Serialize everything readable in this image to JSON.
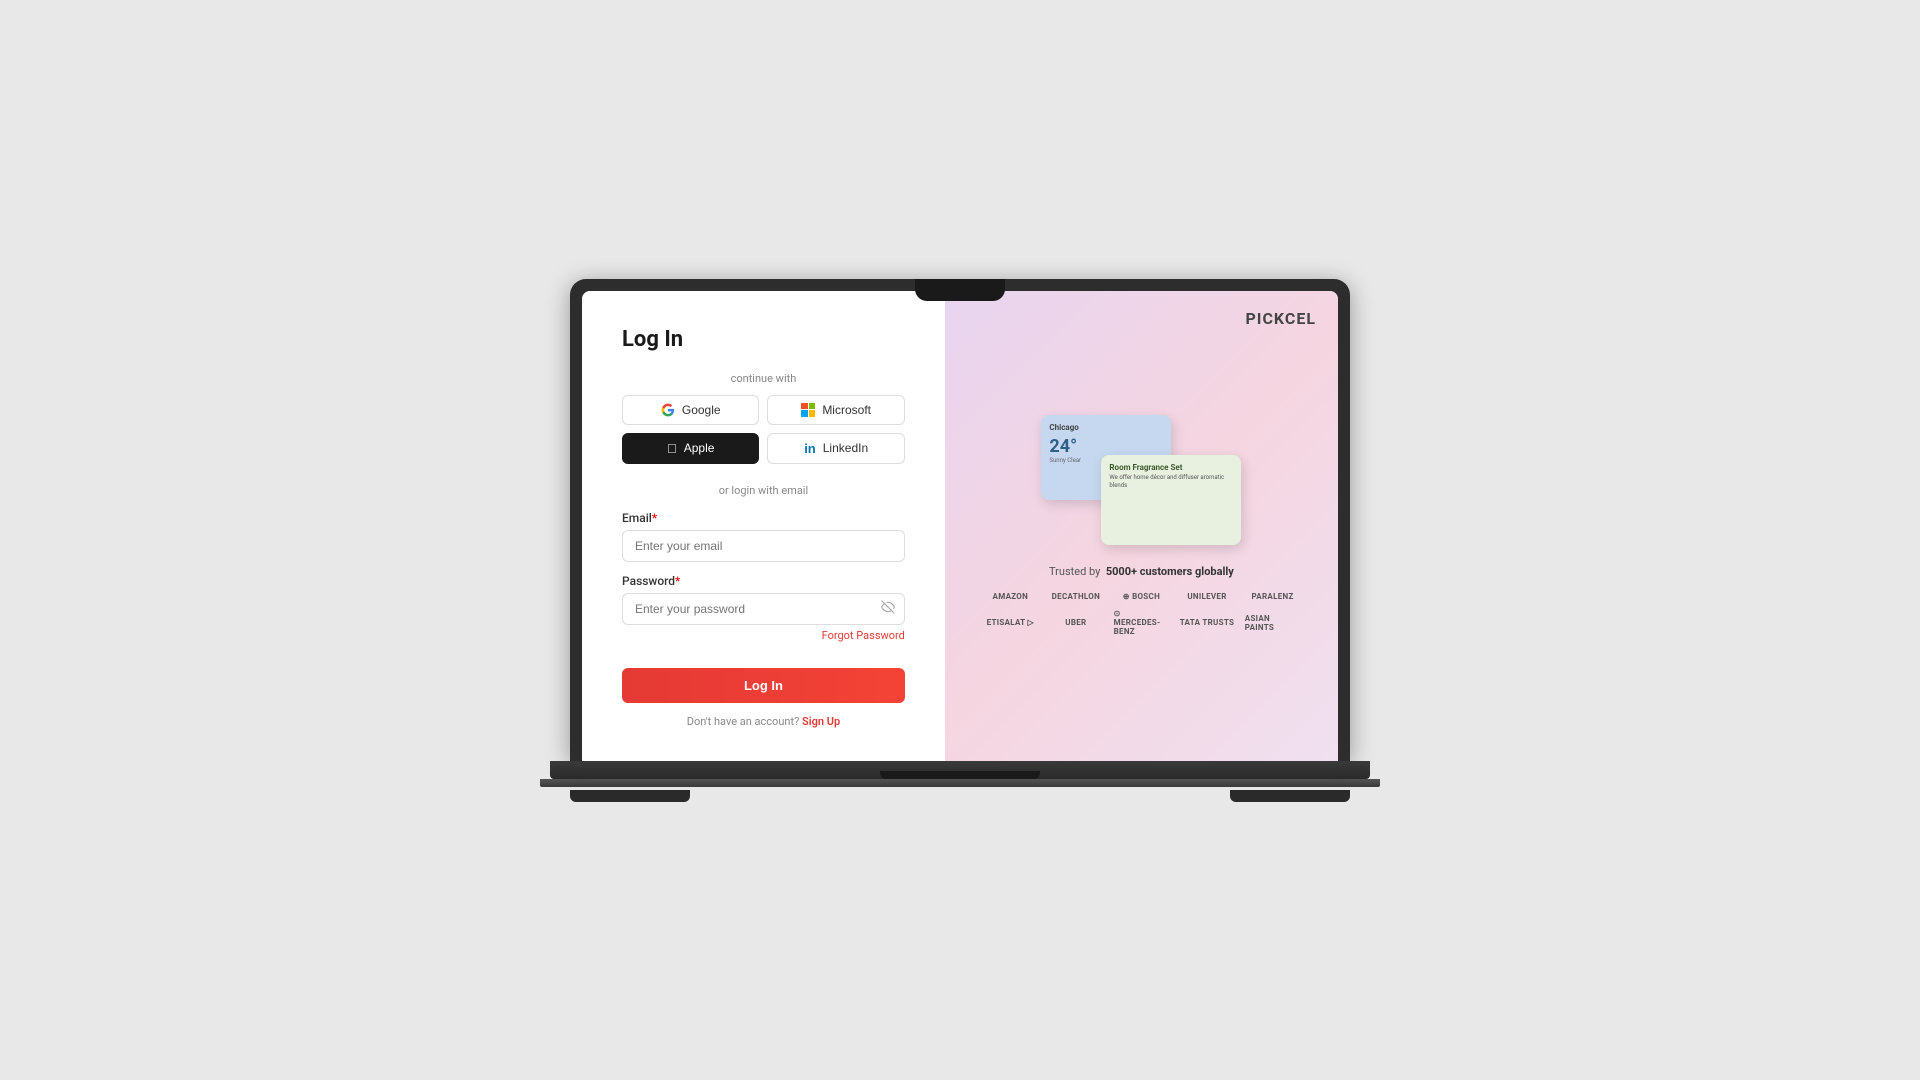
{
  "app": {
    "name": "Pickcel",
    "logo_text": "PICKCEL"
  },
  "laptop": {
    "visible": true
  },
  "login_panel": {
    "title": "Log In",
    "continue_with_label": "continue with",
    "or_email_label": "or login with email",
    "social_buttons": [
      {
        "id": "google",
        "label": "Google"
      },
      {
        "id": "microsoft",
        "label": "Microsoft"
      },
      {
        "id": "apple",
        "label": "Apple"
      },
      {
        "id": "linkedin",
        "label": "LinkedIn"
      }
    ],
    "email_field": {
      "label": "Email",
      "placeholder": "Enter your email",
      "required": true
    },
    "password_field": {
      "label": "Password",
      "placeholder": "Enter your password",
      "required": true
    },
    "forgot_password_label": "Forgot Password",
    "login_button_label": "Log In",
    "signup_prompt": "Don't have an account?",
    "signup_link_label": "Sign Up"
  },
  "right_panel": {
    "trusted_text_prefix": "Trusted by",
    "trusted_count": "5000+ customers globally",
    "brands_row1": [
      "amazon",
      "DECATHLON",
      "BOSCH",
      "Unilever",
      "PARALENZ"
    ],
    "brands_row2": [
      "etisalat",
      "Uber",
      "Mercedes-Benz",
      "TATA TRUSTS",
      "asianpaints"
    ]
  }
}
